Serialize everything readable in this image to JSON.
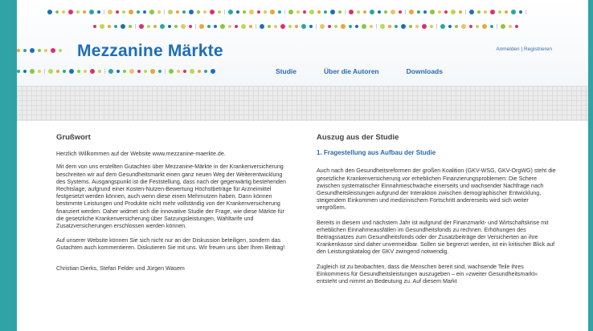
{
  "site": {
    "title": "Mezzanine Märkte",
    "auth_login": "Anmelden",
    "auth_sep": " | ",
    "auth_register": "Registrieren"
  },
  "nav": [
    "Studie",
    "Über die Autoren",
    "Downloads"
  ],
  "left": {
    "heading": "Grußwort",
    "p1": "Herzlich Willkommen auf der Website www.mezzanine-maerkte.de.",
    "p2": "Mit dem von uns erstellten Gutachten über Mezzanine-Märkte in der Krankenversicherung beschreiten wir auf dem Gesundheitsmarkt einen ganz neuen Weg der Weiterentwicklung des Systems. Ausgangspunkt ist die Feststellung, dass nach der gegenwärtig bestehenden Rechtslage, aufgrund einer Kosten-Nutzen-Bewertung Höchstbeträge für Arzneimittel festgesetzt werden können, auch wenn diese einen Mehrnutzen haben. Dann können bestimmte Leistungen und Produkte nicht mehr vollständig von der Krankenversicherung finanziert werden. Daher widmet sich die innovative Studie der Frage, wie diese Märkte für die gesetzliche Krankenversicherung über Satzungsleistungen, Wahltarife und Zusatzversicherungen erschlossen werden können.",
    "p3": "Auf unserer Website können Sie sich nicht nur an der Diskussion beteiligen, sondern das Gutachten auch kommentieren. Diskutieren Sie mit uns. Wir freuen uns über Ihren Beitrag!",
    "signature": "Christian Dierks, Stefan Felder und Jürgen Wasem"
  },
  "right": {
    "heading": "Auszug aus der Studie",
    "subheading": "1. Fragestellung aus Aufbau der Studie",
    "p1": "Auch nach den Gesundheitsreformen der großen Koalition (GKV-WSG, GKV-OrgWG) steht die gesetzliche Krankenversicherung vor erheblichen Finanzierungsproblemen: Die Schere zwischen systematischer Einnahmeschwäche einerseits und wachsender Nachfrage nach Gesundheitsleistungen aufgrund der Interaktion zwischen demographischer Entwicklung, steigendem Einkommen und medizinischem Fortschritt andererseits wird sich weiter vergrößern.",
    "p2": "Bereits in diesem und nächstem Jahr ist aufgrund der Finanzmarkt- und Wirtschaftskrise mit erheblichen Einnahmeausfällen im Gesundheitsfonds zu rechnen. Erhöhungen des Beitragssatzes zum Gesundheitsfonds oder der Zusatzbeiträge der Versicherten an ihre Krankenkasse sind daher unvermeidbar. Sollen sie begrenzt werden, ist ein kritischer Blick auf den Leistungskatalog der GKV zwingend notwendig.",
    "p3": "Zugleich ist zu beobachten, dass die Menschen bereit sind, wachsende Teile ihres Einkommens für Gesundheitsleistungen auszugeben – ein »zweiter Gesundheitsmarkt« entsteht und nimmt an Bedeutung zu. Auf diesem Markt"
  },
  "colors": {
    "dots": [
      "#1f6fb2",
      "#e8a63a",
      "#d6336c",
      "#8cc63f",
      "#2aa6a0",
      "#b7d957",
      "#e9c46a"
    ]
  }
}
